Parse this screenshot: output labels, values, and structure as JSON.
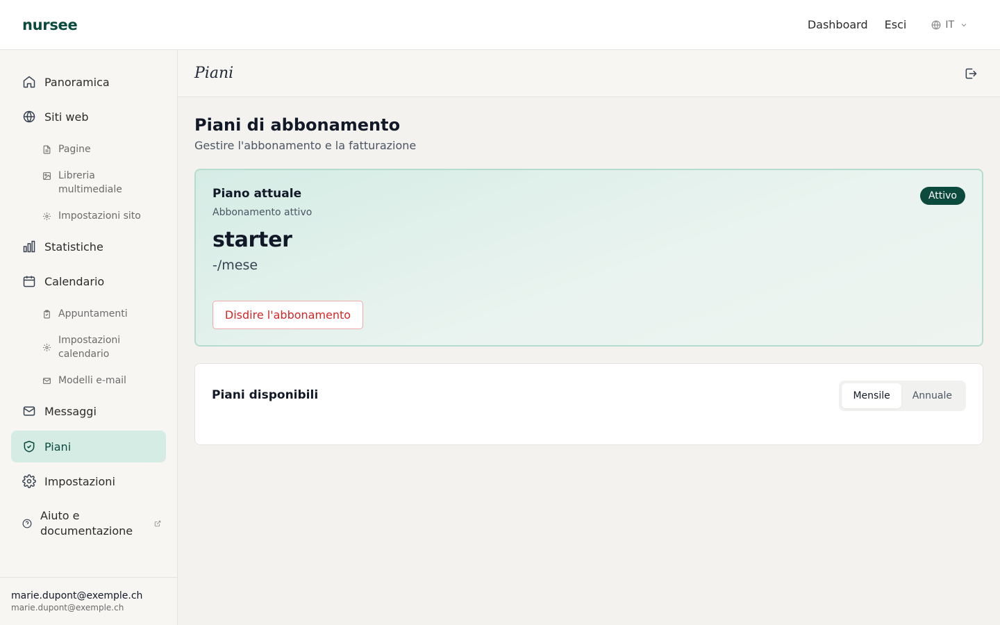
{
  "header": {
    "logo": "nursee",
    "links": [
      "Dashboard",
      "Esci"
    ],
    "lang": "IT"
  },
  "sidebar": {
    "items": [
      {
        "label": "Panoramica",
        "icon": "home-icon"
      },
      {
        "label": "Siti web",
        "icon": "globe-icon"
      },
      {
        "label": "Pagine",
        "icon": "file-icon"
      },
      {
        "label": "Libreria multimediale",
        "icon": "image-icon"
      },
      {
        "label": "Impostazioni sito",
        "icon": "gear-icon"
      },
      {
        "label": "Statistiche",
        "icon": "bar-chart-icon"
      },
      {
        "label": "Calendario",
        "icon": "calendar-icon"
      },
      {
        "label": "Appuntamenti",
        "icon": "clipboard-icon"
      },
      {
        "label": "Impostazioni calendario",
        "icon": "gear-icon"
      },
      {
        "label": "Modelli e-mail",
        "icon": "mail-icon"
      },
      {
        "label": "Messaggi",
        "icon": "mail-icon"
      },
      {
        "label": "Piani",
        "icon": "shield-icon",
        "active": true
      },
      {
        "label": "Impostazioni",
        "icon": "gear-icon"
      }
    ],
    "help": "Aiuto e documentazione",
    "user": {
      "name": "marie.dupont@exemple.ch",
      "email": "marie.dupont@exemple.ch"
    }
  },
  "page": {
    "title": "Piani",
    "heading": "Piani di abbonamento",
    "subheading": "Gestire l'abbonamento e la fatturazione"
  },
  "current_plan": {
    "title": "Piano attuale",
    "subtitle": "Abbonamento attivo",
    "badge": "Attivo",
    "plan_name": "starter",
    "price": "-/mese",
    "cancel_label": "Disdire l'abbonamento"
  },
  "available_plans": {
    "title": "Piani disponibili",
    "options": [
      "Mensile",
      "Annuale"
    ],
    "selected": "Mensile"
  },
  "colors": {
    "brand": "#0b4a3c",
    "active_bg": "#d4ece4",
    "danger": "#d32626"
  }
}
